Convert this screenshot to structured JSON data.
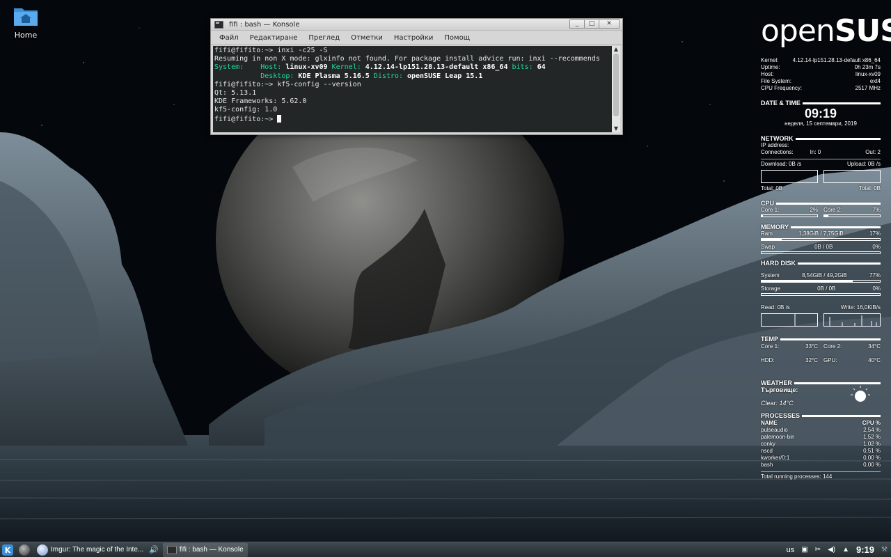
{
  "desktop": {
    "icons": [
      {
        "label": "Home",
        "icon": "folder-home-icon"
      }
    ]
  },
  "konsole": {
    "title": "fifi : bash — Konsole",
    "title_buttons": [
      "_",
      "□",
      "✕"
    ],
    "menu": [
      "Файл",
      "Редактиране",
      "Преглед",
      "Отметки",
      "Настройки",
      "Помощ"
    ],
    "terminal": {
      "l1_prompt": "fifi@fifito:~> ",
      "l1_cmd": "inxi -c25 -S",
      "l2": "Resuming in non X mode: glxinfo not found. For package install advice run: inxi --recommends",
      "l3_label1": "System:    Host: ",
      "l3_val1": "linux-xv09",
      "l3_label2": " Kernel: ",
      "l3_val2": "4.12.14-lp151.28.13-default x86_64",
      "l3_label3": " bits: ",
      "l3_val3": "64",
      "l4_label1": "           Desktop: ",
      "l4_val1": "KDE Plasma 5.16.5",
      "l4_label2": " Distro: ",
      "l4_val2": "openSUSE Leap 15.1",
      "l5_prompt": "fifi@fifito:~> ",
      "l5_cmd": "kf5-config --version",
      "l6": "Qt: 5.13.1",
      "l7": "KDE Frameworks: 5.62.0",
      "l8": "kf5-config: 1.0",
      "l9_prompt": "fifi@fifito:~> "
    }
  },
  "conky": {
    "logo_a": "open",
    "logo_b": "SUSE",
    "system": [
      {
        "label": "Kernel:",
        "value": "4.12.14-lp151.28.13-default  x86_64"
      },
      {
        "label": "Uptime:",
        "value": "0h 23m 7s"
      },
      {
        "label": "Host:",
        "value": "linux-xv09"
      },
      {
        "label": "File System:",
        "value": "ext4"
      },
      {
        "label": "CPU Frequency:",
        "value": "2517 MHz"
      }
    ],
    "datetime": {
      "title": "DATE & TIME",
      "time": "09:19",
      "date": "неделя, 15 септември, 2019"
    },
    "network": {
      "title": "NETWORK",
      "ip_label": "IP address:",
      "conn_label": "Connections:",
      "in_label": "In: 0",
      "out_label": "Out: 2",
      "download": "Download: 0B  /s",
      "upload": "Upload: 0B  /s",
      "total_down": "Total: 0B",
      "total_up": "Total: 0B"
    },
    "cpu": {
      "title": "CPU",
      "core1_label": "Core 1:",
      "core1_value": "2%",
      "core1_fraction": 0.02,
      "core2_label": "Core 2:",
      "core2_value": "7%",
      "core2_fraction": 0.07
    },
    "memory": {
      "title": "MEMORY",
      "ram_label": "Ram",
      "ram_value": "1,38GiB / 7,75GiB",
      "ram_pct": "17%",
      "ram_fraction": 0.17,
      "swap_label": "Swap",
      "swap_value": "0B   / 0B",
      "swap_pct": "0%",
      "swap_fraction": 0
    },
    "disk": {
      "title": "HARD DISK",
      "sys_label": "System",
      "sys_value": "8,54GiB / 49,2GiB",
      "sys_pct": "77%",
      "sys_fraction": 0.77,
      "stor_label": "Storage",
      "stor_value": "0B   / 0B",
      "stor_pct": "0%",
      "stor_fraction": 0,
      "read": "Read: 0B  /s",
      "write": "Write: 16,0KiB/s"
    },
    "temp": {
      "title": "TEMP",
      "core1_label": "Core 1:",
      "core1_value": "33°C",
      "core2_label": "Core 2:",
      "core2_value": "34°C",
      "hdd_label": "HDD:",
      "hdd_value": "32°C",
      "gpu_label": "GPU:",
      "gpu_value": "40°C"
    },
    "weather": {
      "title": "WEATHER",
      "city": "Търговище:",
      "condition": "Clear: 14°C",
      "icon": "sun-icon"
    },
    "processes": {
      "title": "PROCESSES",
      "col_name": "NAME",
      "col_cpu": "CPU %",
      "rows": [
        {
          "name": "pulseaudio",
          "cpu": "2,54 %"
        },
        {
          "name": "palemoon-bin",
          "cpu": "1,52 %"
        },
        {
          "name": "conky",
          "cpu": "1,02 %"
        },
        {
          "name": "nscd",
          "cpu": "0,51 %"
        },
        {
          "name": "kworker/0:1",
          "cpu": "0,00 %"
        },
        {
          "name": "bash",
          "cpu": "0,00 %"
        }
      ],
      "total": "Total running processes: 144"
    }
  },
  "taskbar": {
    "tasks": [
      {
        "label": "Imgur: The magic of the Inte...",
        "icon": "palemoon-icon"
      },
      {
        "label": "fifi : bash — Konsole",
        "icon": "terminal-icon"
      }
    ],
    "keyboard_layout": "us",
    "clock": "9:19"
  }
}
